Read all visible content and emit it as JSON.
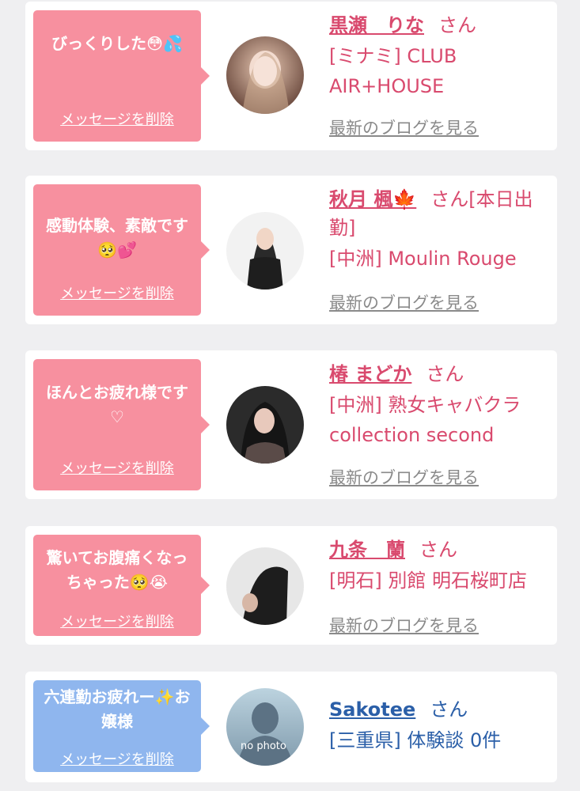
{
  "items": [
    {
      "message": "びっくりした😳💦",
      "delete_label": "メッセージを削除",
      "name": "黒瀬　りな",
      "honorific": "さん",
      "detail": "[ミナミ] CLUB AIR+HOUSE",
      "blog_label": "最新のブログを見る"
    },
    {
      "message": "感動体験、素敵です🥺💕",
      "delete_label": "メッセージを削除",
      "name": "秋月 楓🍁",
      "honorific": "さん[本日出勤]",
      "detail": "[中洲] Moulin Rouge",
      "blog_label": "最新のブログを見る"
    },
    {
      "message": "ほんとお疲れ様です♡",
      "delete_label": "メッセージを削除",
      "name": "椿 まどか",
      "honorific": "さん",
      "detail": "[中洲] 熟女キャバクラ collection second",
      "blog_label": "最新のブログを見る"
    },
    {
      "message": "驚いてお腹痛くなっちゃった🥺😭",
      "delete_label": "メッセージを削除",
      "name": "九条　蘭",
      "honorific": "さん",
      "detail": "[明石] 別館 明石桜町店",
      "blog_label": "最新のブログを見る"
    },
    {
      "message": "六連勤お疲れー✨お嬢様",
      "delete_label": "メッセージを削除",
      "name": "Sakotee",
      "honorific": "さん",
      "detail": "[三重県] 体験談 0件",
      "avatar_text": "no photo"
    }
  ],
  "colors": {
    "pink_bubble": "#f7909f",
    "blue_bubble": "#8fb6ee",
    "pink_text": "#d94a6e",
    "blue_text": "#2b5fa8",
    "blog_gray": "#8a8a8a"
  },
  "icons": [
    "avatar-photo",
    "no-photo-silhouette-icon"
  ]
}
